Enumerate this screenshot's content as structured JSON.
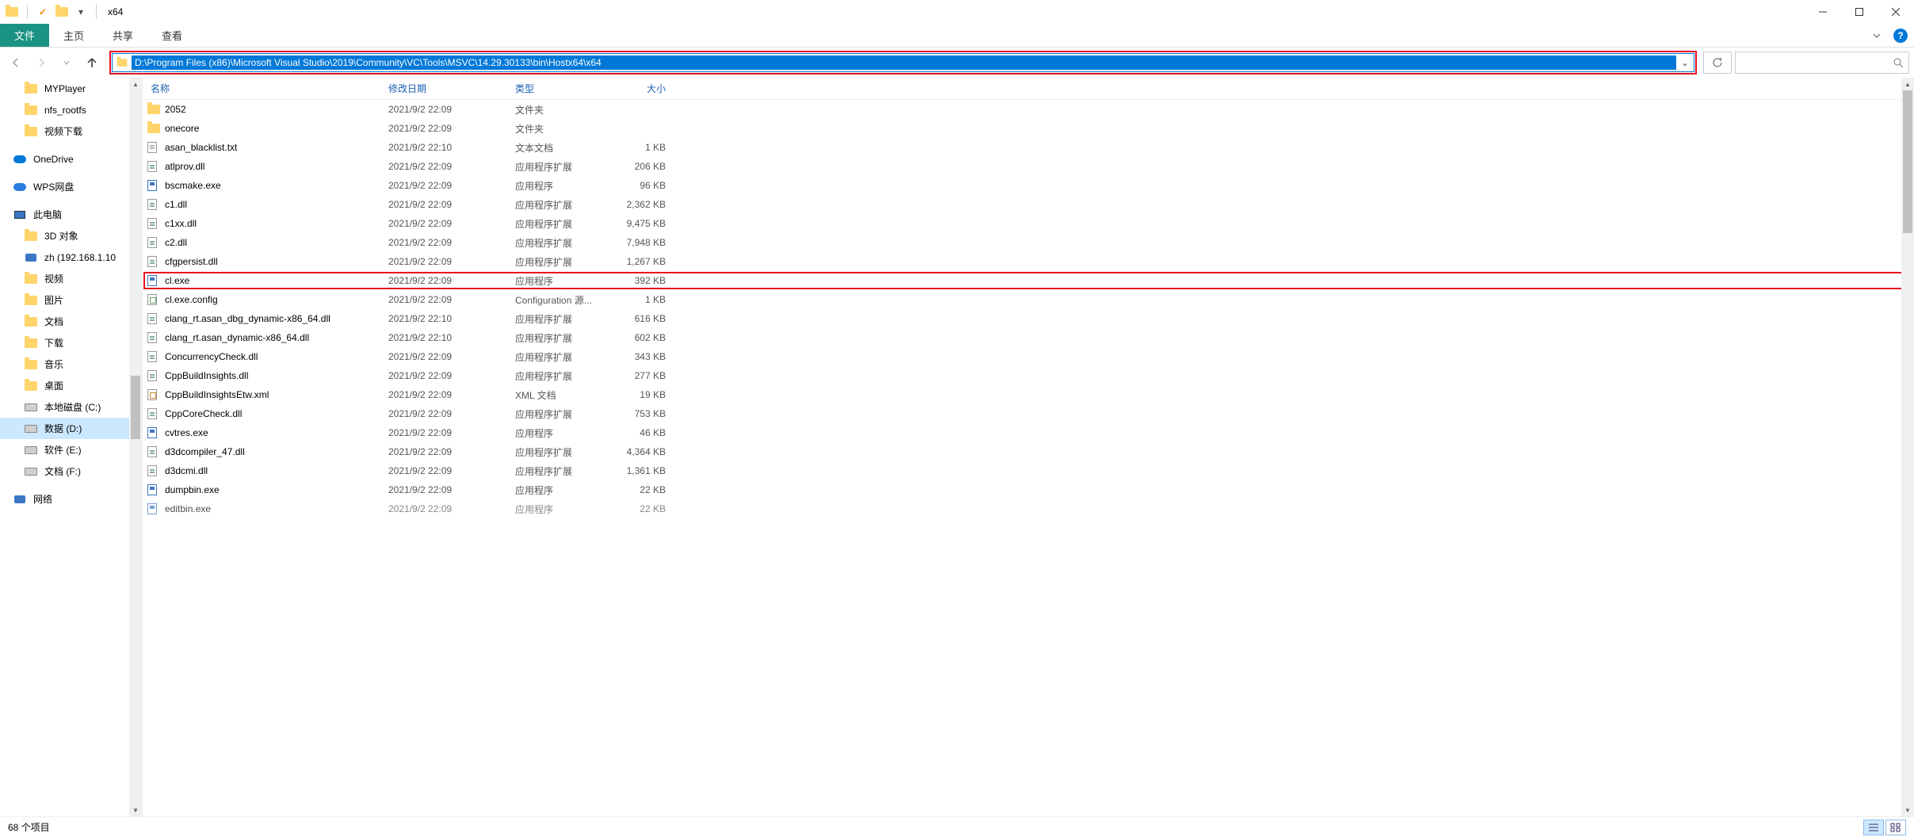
{
  "window": {
    "title": "x64"
  },
  "ribbon": {
    "file": "文件",
    "tabs": [
      "主页",
      "共享",
      "查看"
    ]
  },
  "address": {
    "path": "D:\\Program Files (x86)\\Microsoft Visual Studio\\2019\\Community\\VC\\Tools\\MSVC\\14.29.30133\\bin\\Hostx64\\x64"
  },
  "tree": {
    "items": [
      {
        "label": "MYPlayer",
        "icon": "folder",
        "indent": 1
      },
      {
        "label": "nfs_rootfs",
        "icon": "folder",
        "indent": 1
      },
      {
        "label": "视频下载",
        "icon": "folder",
        "indent": 1
      }
    ],
    "onedrive": "OneDrive",
    "wps": "WPS网盘",
    "thispc": "此电脑",
    "pcitems": [
      {
        "label": "3D 对象",
        "icon": "folder"
      },
      {
        "label": "zh (192.168.1.10",
        "icon": "net"
      },
      {
        "label": "视频",
        "icon": "folder"
      },
      {
        "label": "图片",
        "icon": "folder"
      },
      {
        "label": "文档",
        "icon": "folder"
      },
      {
        "label": "下载",
        "icon": "folder"
      },
      {
        "label": "音乐",
        "icon": "folder"
      },
      {
        "label": "桌面",
        "icon": "folder"
      },
      {
        "label": "本地磁盘 (C:)",
        "icon": "drive"
      },
      {
        "label": "数据 (D:)",
        "icon": "drive",
        "selected": true
      },
      {
        "label": "软件 (E:)",
        "icon": "drive"
      },
      {
        "label": "文档 (F:)",
        "icon": "drive"
      }
    ],
    "network": "网络"
  },
  "columns": {
    "name": "名称",
    "date": "修改日期",
    "type": "类型",
    "size": "大小"
  },
  "files": [
    {
      "name": "2052",
      "date": "2021/9/2 22:09",
      "type": "文件夹",
      "size": "",
      "icon": "folder"
    },
    {
      "name": "onecore",
      "date": "2021/9/2 22:09",
      "type": "文件夹",
      "size": "",
      "icon": "folder"
    },
    {
      "name": "asan_blacklist.txt",
      "date": "2021/9/2 22:10",
      "type": "文本文档",
      "size": "1 KB",
      "icon": "txt"
    },
    {
      "name": "atlprov.dll",
      "date": "2021/9/2 22:09",
      "type": "应用程序扩展",
      "size": "206 KB",
      "icon": "dll"
    },
    {
      "name": "bscmake.exe",
      "date": "2021/9/2 22:09",
      "type": "应用程序",
      "size": "96 KB",
      "icon": "exe"
    },
    {
      "name": "c1.dll",
      "date": "2021/9/2 22:09",
      "type": "应用程序扩展",
      "size": "2,362 KB",
      "icon": "dll"
    },
    {
      "name": "c1xx.dll",
      "date": "2021/9/2 22:09",
      "type": "应用程序扩展",
      "size": "9,475 KB",
      "icon": "dll"
    },
    {
      "name": "c2.dll",
      "date": "2021/9/2 22:09",
      "type": "应用程序扩展",
      "size": "7,948 KB",
      "icon": "dll"
    },
    {
      "name": "cfgpersist.dll",
      "date": "2021/9/2 22:09",
      "type": "应用程序扩展",
      "size": "1,267 KB",
      "icon": "dll"
    },
    {
      "name": "cl.exe",
      "date": "2021/9/2 22:09",
      "type": "应用程序",
      "size": "392 KB",
      "icon": "exe",
      "boxed": true
    },
    {
      "name": "cl.exe.config",
      "date": "2021/9/2 22:09",
      "type": "Configuration 源...",
      "size": "1 KB",
      "icon": "cfg"
    },
    {
      "name": "clang_rt.asan_dbg_dynamic-x86_64.dll",
      "date": "2021/9/2 22:10",
      "type": "应用程序扩展",
      "size": "616 KB",
      "icon": "dll"
    },
    {
      "name": "clang_rt.asan_dynamic-x86_64.dll",
      "date": "2021/9/2 22:10",
      "type": "应用程序扩展",
      "size": "602 KB",
      "icon": "dll"
    },
    {
      "name": "ConcurrencyCheck.dll",
      "date": "2021/9/2 22:09",
      "type": "应用程序扩展",
      "size": "343 KB",
      "icon": "dll"
    },
    {
      "name": "CppBuildInsights.dll",
      "date": "2021/9/2 22:09",
      "type": "应用程序扩展",
      "size": "277 KB",
      "icon": "dll"
    },
    {
      "name": "CppBuildInsightsEtw.xml",
      "date": "2021/9/2 22:09",
      "type": "XML 文档",
      "size": "19 KB",
      "icon": "xml"
    },
    {
      "name": "CppCoreCheck.dll",
      "date": "2021/9/2 22:09",
      "type": "应用程序扩展",
      "size": "753 KB",
      "icon": "dll"
    },
    {
      "name": "cvtres.exe",
      "date": "2021/9/2 22:09",
      "type": "应用程序",
      "size": "46 KB",
      "icon": "exe"
    },
    {
      "name": "d3dcompiler_47.dll",
      "date": "2021/9/2 22:09",
      "type": "应用程序扩展",
      "size": "4,364 KB",
      "icon": "dll"
    },
    {
      "name": "d3dcmi.dll",
      "date": "2021/9/2 22:09",
      "type": "应用程序扩展",
      "size": "1,361 KB",
      "icon": "dll"
    },
    {
      "name": "dumpbin.exe",
      "date": "2021/9/2 22:09",
      "type": "应用程序",
      "size": "22 KB",
      "icon": "exe"
    },
    {
      "name": "editbin.exe",
      "date": "2021/9/2 22:09",
      "type": "应用程序",
      "size": "22 KB",
      "icon": "exe",
      "partial": true
    }
  ],
  "status": {
    "text": "68 个项目"
  }
}
